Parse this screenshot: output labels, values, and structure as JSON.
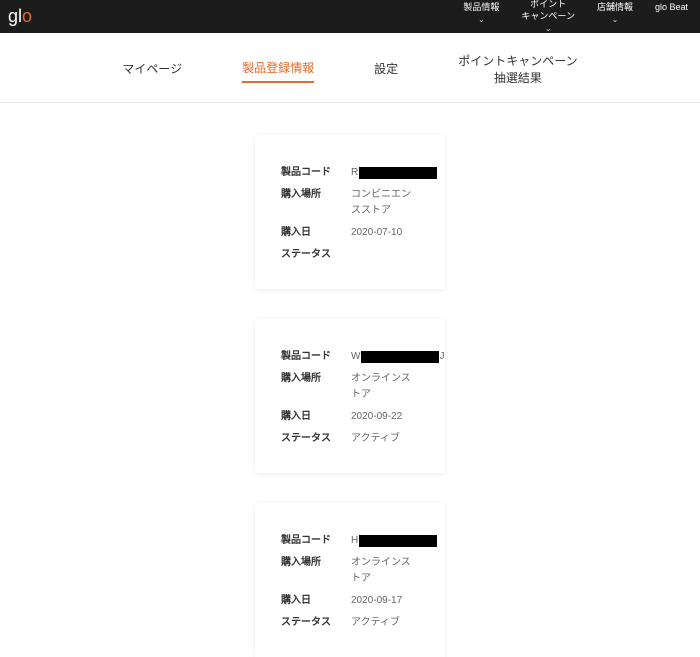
{
  "brand": {
    "g": "g",
    "l": "l",
    "o": "o"
  },
  "nav": {
    "products": "製品情報",
    "points_l1": "ポイント",
    "points_l2": "キャンペーン",
    "stores": "店舗情報",
    "beat": "glo Beat"
  },
  "tabs": {
    "mypage": "マイページ",
    "register": "製品登録情報",
    "settings": "設定",
    "lottery_l1": "ポイントキャンペーン",
    "lottery_l2": "抽選結果"
  },
  "labels": {
    "code": "製品コード",
    "place": "購入場所",
    "date": "購入日",
    "status": "ステータス"
  },
  "cards": [
    {
      "code_prefix": "R",
      "code_suffix": "",
      "place": "コンビニエンスストア",
      "date": "2020-07-10",
      "status": ""
    },
    {
      "code_prefix": "W",
      "code_suffix": "J",
      "place": "オンラインストア",
      "date": "2020-09-22",
      "status": "アクティブ"
    },
    {
      "code_prefix": "H",
      "code_suffix": "",
      "place": "オンラインストア",
      "date": "2020-09-17",
      "status": "アクティブ"
    }
  ]
}
